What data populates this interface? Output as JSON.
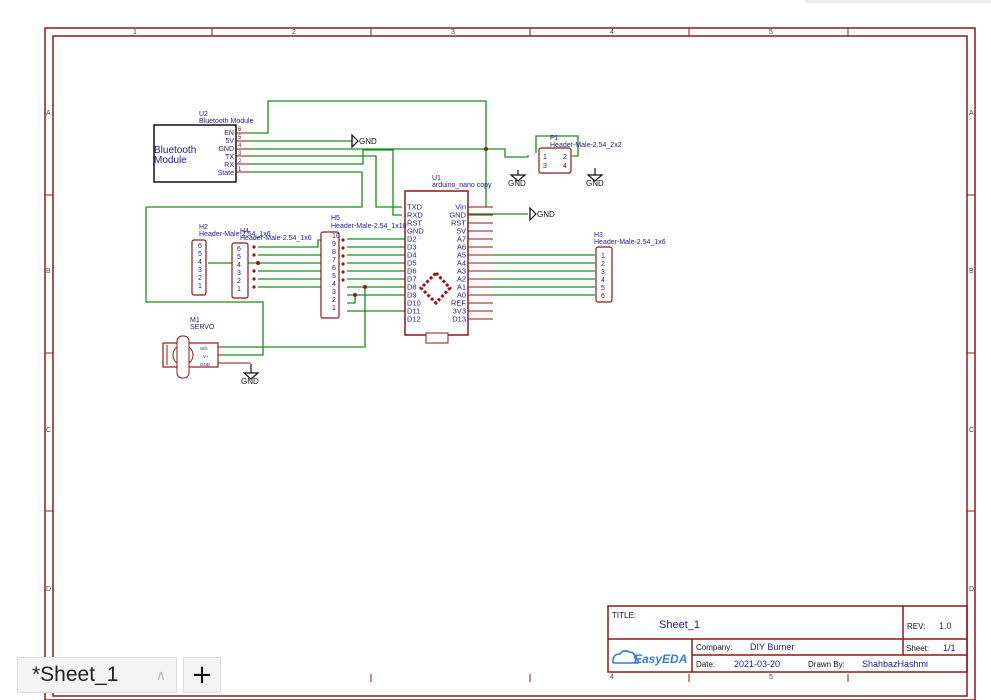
{
  "sheet": {
    "col_labels": [
      "1",
      "2",
      "3",
      "4",
      "5"
    ],
    "row_labels": [
      "A",
      "B",
      "C",
      "D"
    ]
  },
  "components": {
    "u2": {
      "ref": "U2",
      "name": "Bluetooth Module",
      "body_label_1": "Bluetooth",
      "body_label_2": "Module",
      "pins": [
        "EN",
        "5V",
        "GND",
        "TX",
        "RX",
        "State"
      ],
      "pin_numbers": [
        "6",
        "5",
        "4",
        "3",
        "2",
        "1"
      ]
    },
    "p1": {
      "ref": "P1",
      "name": "Header-Male-2.54_2x2",
      "pins": [
        "1",
        "2",
        "3",
        "4"
      ]
    },
    "u1": {
      "ref": "U1",
      "name": "arduino_nano copy",
      "left_pins": [
        "TXD",
        "RXD",
        "RST",
        "GND",
        "D2",
        "D3",
        "D4",
        "D5",
        "D6",
        "D7",
        "D8",
        "D9",
        "D10",
        "D11",
        "D12"
      ],
      "right_pins": [
        "Vin",
        "GND",
        "RST",
        "5V",
        "A7",
        "A6",
        "A5",
        "A4",
        "A3",
        "A2",
        "A1",
        "A0",
        "REF",
        "3V3",
        "D13"
      ]
    },
    "h2": {
      "ref": "H2",
      "name": "Header-Male-2.54_1x6",
      "pins": [
        "6",
        "5",
        "4",
        "3",
        "2",
        "1"
      ]
    },
    "h4": {
      "ref": "H4",
      "name": "Header-Male-2.54_1x6",
      "pins": [
        "6",
        "5",
        "4",
        "3",
        "2",
        "1"
      ]
    },
    "h5": {
      "ref": "H5",
      "name": "Header-Male-2.54_1x10",
      "pins": [
        "10",
        "9",
        "8",
        "7",
        "6",
        "5",
        "4",
        "3",
        "2",
        "1"
      ]
    },
    "h3": {
      "ref": "H3",
      "name": "Header-Male-2.54_1x6",
      "pins": [
        "1",
        "2",
        "3",
        "4",
        "5",
        "6"
      ]
    },
    "m1": {
      "ref": "M1",
      "name": "SERVO",
      "pins": [
        "SIG",
        "V+",
        "GND"
      ]
    },
    "gnd_label": "GND"
  },
  "title_block": {
    "title_label": "TITLE:",
    "title": "Sheet_1",
    "rev_label": "REV:",
    "rev": "1.0",
    "company_label": "Company:",
    "company": "DIY Burner",
    "sheet_label": "Sheet:",
    "sheet": "1/1",
    "date_label": "Date:",
    "date": "2021-03-20",
    "drawn_label": "Drawn By:",
    "drawn_by": "ShahbazHashmi",
    "logo": "EasyEDA"
  },
  "tabs": [
    {
      "label": "*Sheet_1"
    }
  ],
  "add_tab_label": "+",
  "colors": {
    "frame": "#8b1a1a",
    "wire": "#1a8c1a",
    "text_blue": "#1a1a8b",
    "component": "#8b1a1a"
  }
}
